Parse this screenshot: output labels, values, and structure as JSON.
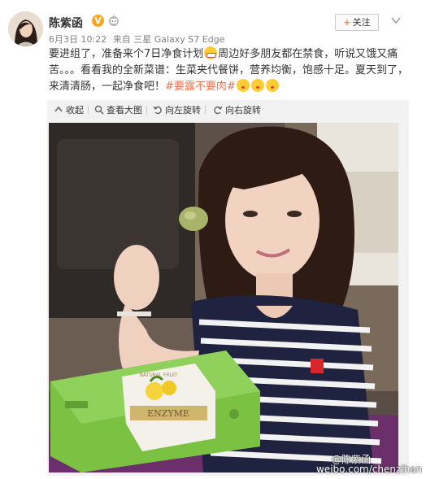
{
  "post": {
    "username": "陈紫函",
    "verified_badge": "V",
    "follow_plus": "+",
    "follow_label": "关注",
    "date": "6月3日 10:22",
    "source_prefix": "来自",
    "device": "三星 Galaxy S7 Edge",
    "text_line1_a": "要进组了，准备来个7日净食计划",
    "text_line1_b": "周边好多朋友都在禁食，听说又饿又痛",
    "text_line2": "苦。。。看看我的全新菜谱：生菜夹代餐饼，营养均衡，饱感十足。夏天到了，",
    "text_line3_a": "来清清肠，一起净食吧！",
    "hashtag": "#要露不要肉#"
  },
  "toolbar": {
    "collapse_label": "收起",
    "view_large_label": "查看大图",
    "rotate_left_label": "向左旋转",
    "rotate_right_label": "向右旋转"
  },
  "photo": {
    "box_brand": "ENZYME",
    "box_small_text": "NATURAL FRUIT"
  },
  "watermark": {
    "handle": "@陈紫函",
    "url": "weibo.com/chenzihan"
  },
  "colors": {
    "accent_orange": "#fa7d3c",
    "hashtag": "#eb7350",
    "verified": "#f5a623",
    "box_green": "#7cc242"
  },
  "icons": {
    "verified": "verified-v-icon",
    "robot": "robot-icon",
    "menu": "chevron-down-icon",
    "collapse": "collapse-arrow-icon",
    "view_large": "magnify-icon",
    "rotate_left": "rotate-left-icon",
    "rotate_right": "rotate-right-icon"
  }
}
